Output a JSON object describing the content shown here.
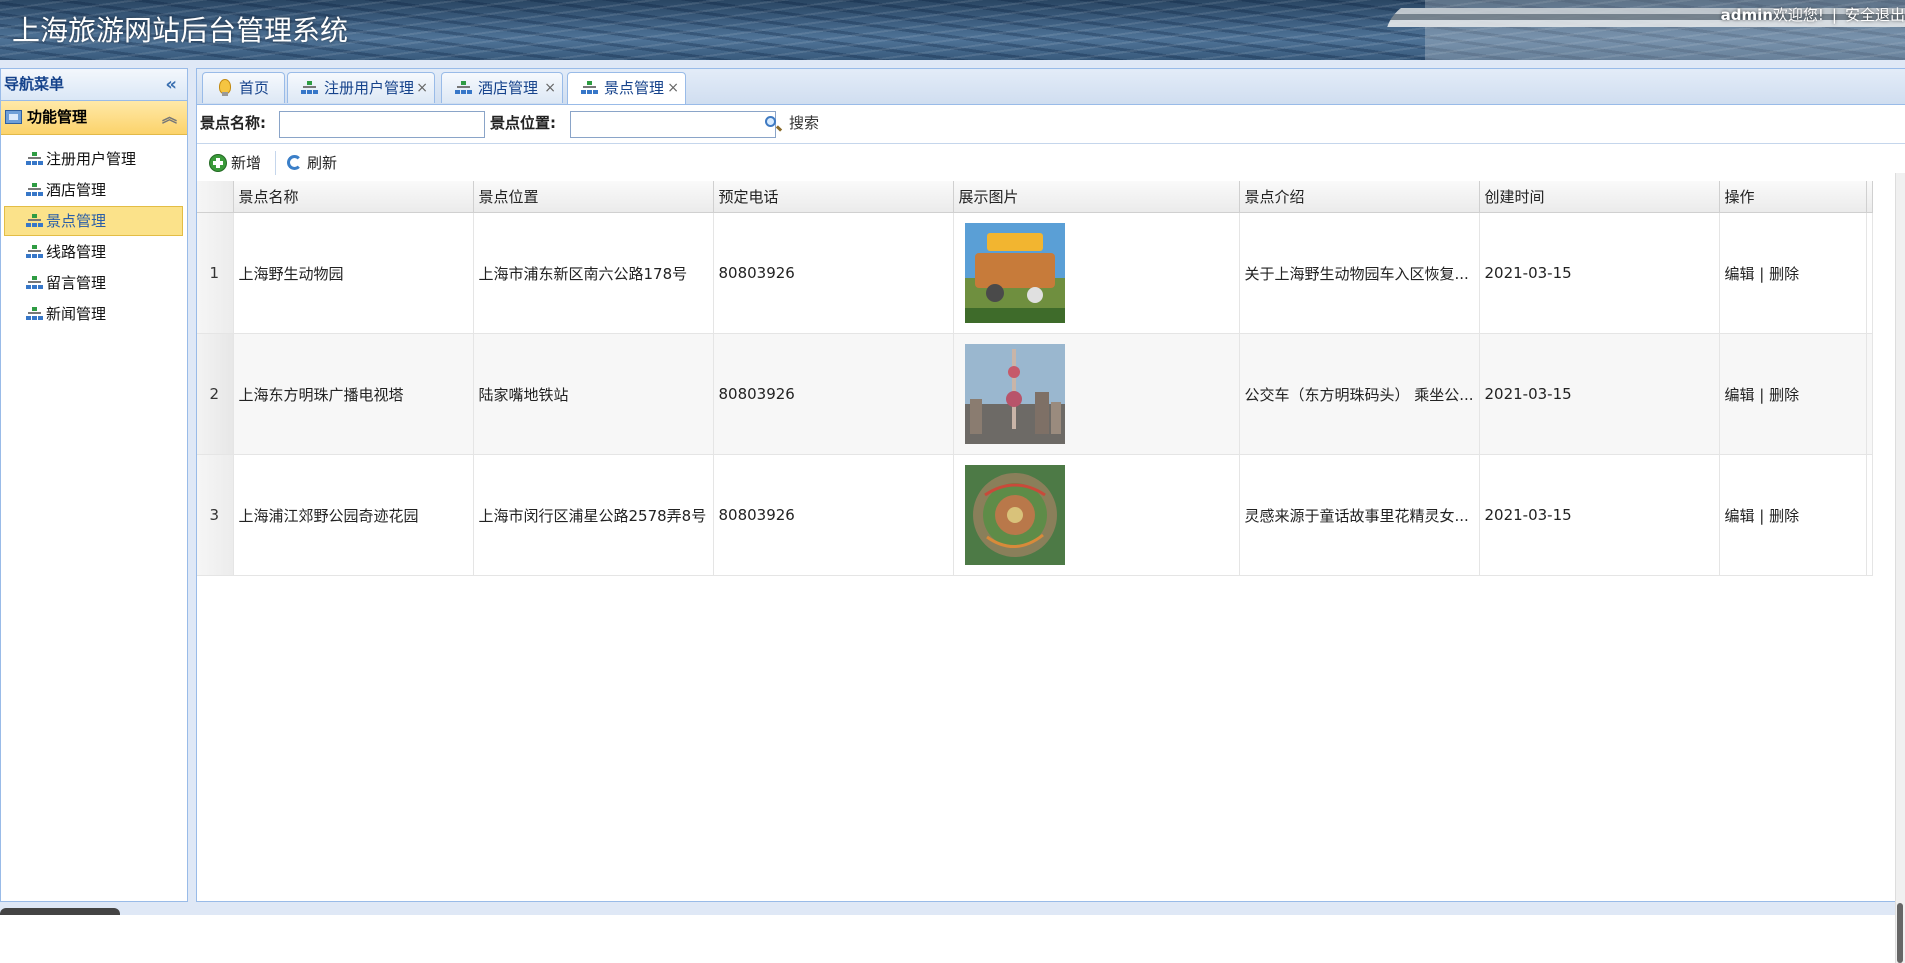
{
  "header": {
    "title": "上海旅游网站后台管理系统",
    "user": "admin",
    "welcome": "欢迎您!",
    "separator": "|",
    "logout": "安全退出"
  },
  "sidebar": {
    "title": "导航菜单",
    "group": "功能管理",
    "items": [
      {
        "label": "注册用户管理"
      },
      {
        "label": "酒店管理"
      },
      {
        "label": "景点管理",
        "active": true
      },
      {
        "label": "线路管理"
      },
      {
        "label": "留言管理"
      },
      {
        "label": "新闻管理"
      }
    ]
  },
  "tabs": [
    {
      "label": "首页",
      "icon": "lightbulb-icon",
      "closable": false
    },
    {
      "label": "注册用户管理",
      "icon": "tree-icon",
      "closable": true
    },
    {
      "label": "酒店管理",
      "icon": "tree-icon",
      "closable": true
    },
    {
      "label": "景点管理",
      "icon": "tree-icon",
      "closable": true,
      "active": true
    }
  ],
  "tab_close_glyph": "×",
  "search": {
    "name_label": "景点名称:",
    "name_value": "",
    "location_label": "景点位置:",
    "location_value": "",
    "button": "搜索"
  },
  "toolbar": {
    "add": "新增",
    "refresh": "刷新"
  },
  "grid": {
    "columns": [
      "景点名称",
      "景点位置",
      "预定电话",
      "展示图片",
      "景点介绍",
      "创建时间",
      "操作"
    ],
    "rows": [
      {
        "num": "1",
        "name": "上海野生动物园",
        "location": "上海市浦东新区南六公路178号",
        "phone": "80803926",
        "image": "zoo-photo",
        "intro": "关于上海野生动物园车入区恢复...",
        "created": "2021-03-15",
        "edit": "编辑",
        "sep": "|",
        "delete": "删除"
      },
      {
        "num": "2",
        "name": "上海东方明珠广播电视塔",
        "location": "陆家嘴地铁站",
        "phone": "80803926",
        "image": "oriental-pearl-tower-photo",
        "intro": "公交车（东方明珠码头） 乘坐公...",
        "created": "2021-03-15",
        "edit": "编辑",
        "sep": "|",
        "delete": "删除"
      },
      {
        "num": "3",
        "name": "上海浦江郊野公园奇迹花园",
        "location": "上海市闵行区浦星公路2578弄8号",
        "phone": "80803926",
        "image": "garden-aerial-photo",
        "intro": "灵感来源于童话故事里花精灵女...",
        "created": "2021-03-15",
        "edit": "编辑",
        "sep": "|",
        "delete": "删除"
      }
    ]
  },
  "colors": {
    "accent_border": "#99bbe8",
    "header_text": "#15428b",
    "active_item": "#fbe28a"
  }
}
